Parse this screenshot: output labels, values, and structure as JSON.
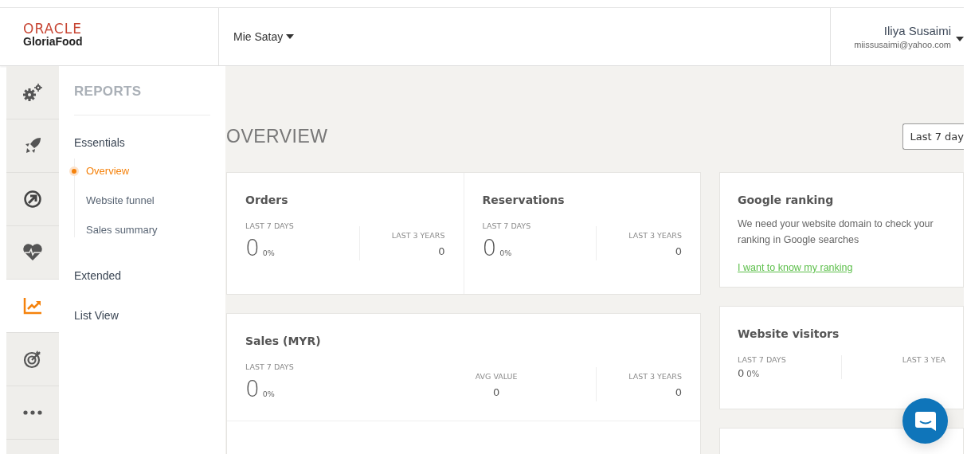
{
  "header": {
    "logo": {
      "brand": "ORACLE",
      "product": "GloriaFood"
    },
    "restaurant": "Mie Satay",
    "user": {
      "name": "Iliya Susaimi",
      "email": "miissusaimi@yahoo.com"
    }
  },
  "rail": [
    {
      "kind": "gears",
      "selected": false
    },
    {
      "kind": "rocket",
      "selected": false
    },
    {
      "kind": "arrow",
      "selected": false
    },
    {
      "kind": "heart",
      "selected": false
    },
    {
      "kind": "chart",
      "selected": true
    },
    {
      "kind": "target",
      "selected": false
    },
    {
      "kind": "more",
      "selected": false
    }
  ],
  "reports_nav": {
    "title": "REPORTS",
    "sections": [
      {
        "label": "Essentials",
        "children": [
          {
            "label": "Overview",
            "selected": true
          },
          {
            "label": "Website funnel",
            "selected": false
          },
          {
            "label": "Sales summary",
            "selected": false
          }
        ]
      },
      {
        "label": "Extended"
      },
      {
        "label": "List View"
      }
    ]
  },
  "page_title": "OVERVIEW",
  "period_select": {
    "value": "Last 7 day"
  },
  "left_cards": [
    {
      "kind": "pair",
      "panels": [
        {
          "title": "Orders",
          "period_label": "LAST 7 DAYS",
          "value": "0",
          "change": "0%",
          "total_label": "LAST 3 YEARS",
          "total": "0"
        },
        {
          "title": "Reservations",
          "period_label": "LAST 7 DAYS",
          "value": "0",
          "change": "0%",
          "total_label": "LAST 3 YEARS",
          "total": "0"
        }
      ]
    },
    {
      "kind": "sales",
      "title": "Sales (MYR)",
      "period_label": "LAST 7 DAYS",
      "value": "0",
      "change": "0%",
      "avg_label": "AVG VALUE",
      "avg": "0",
      "total_label": "LAST 3 YEARS",
      "total": "0"
    }
  ],
  "right_cards": [
    {
      "kind": "text",
      "title": "Google ranking",
      "body": "We need your website domain to check your ranking in Google searches",
      "link": "I want to know my ranking"
    },
    {
      "kind": "small",
      "title": "Website visitors",
      "period_label": "LAST 7 DAYS",
      "value": "0",
      "change": "0%",
      "total_label": "LAST 3 YEA"
    },
    {
      "kind": "empty"
    }
  ]
}
